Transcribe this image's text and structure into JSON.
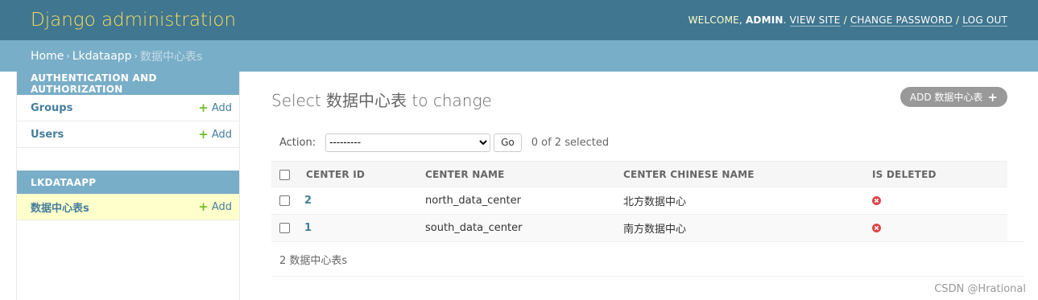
{
  "header": {
    "site_name": "Django administration",
    "welcome": "WELCOME,",
    "username": "ADMIN",
    "view_site": "VIEW SITE",
    "change_password": "CHANGE PASSWORD",
    "log_out": "LOG OUT"
  },
  "breadcrumbs": {
    "home": "Home",
    "app": "Lkdataapp",
    "current": "数据中心表s",
    "separator": "›"
  },
  "sidebar": {
    "modules": [
      {
        "caption": "AUTHENTICATION AND AUTHORIZATION",
        "models": [
          {
            "name": "Groups",
            "add": "Add"
          },
          {
            "name": "Users",
            "add": "Add"
          }
        ]
      },
      {
        "caption": "LKDATAAPP",
        "models": [
          {
            "name": "数据中心表s",
            "add": "Add"
          }
        ]
      }
    ]
  },
  "content": {
    "title": "Select 数据中心表 to change",
    "add_button": "ADD 数据中心表",
    "action_label": "Action:",
    "action_selected": "---------",
    "go_label": "Go",
    "selected_count": "0 of 2 selected",
    "columns": [
      "CENTER ID",
      "CENTER NAME",
      "CENTER CHINESE NAME",
      "IS DELETED"
    ],
    "rows": [
      {
        "id": "2",
        "name": "north_data_center",
        "chinese_name": "北方数据中心",
        "is_deleted": "false"
      },
      {
        "id": "1",
        "name": "south_data_center",
        "chinese_name": "南方数据中心",
        "is_deleted": "false"
      }
    ],
    "paginator": "2 数据中心表s"
  },
  "watermark": "CSDN @Hrational",
  "colors": {
    "header_bg": "#417690",
    "breadcrumb_bg": "#79aec8",
    "site_name": "#f5dd5d",
    "link": "#447e9b",
    "add_plus": "#70bf2b",
    "deleted_icon": "#dd4646"
  }
}
